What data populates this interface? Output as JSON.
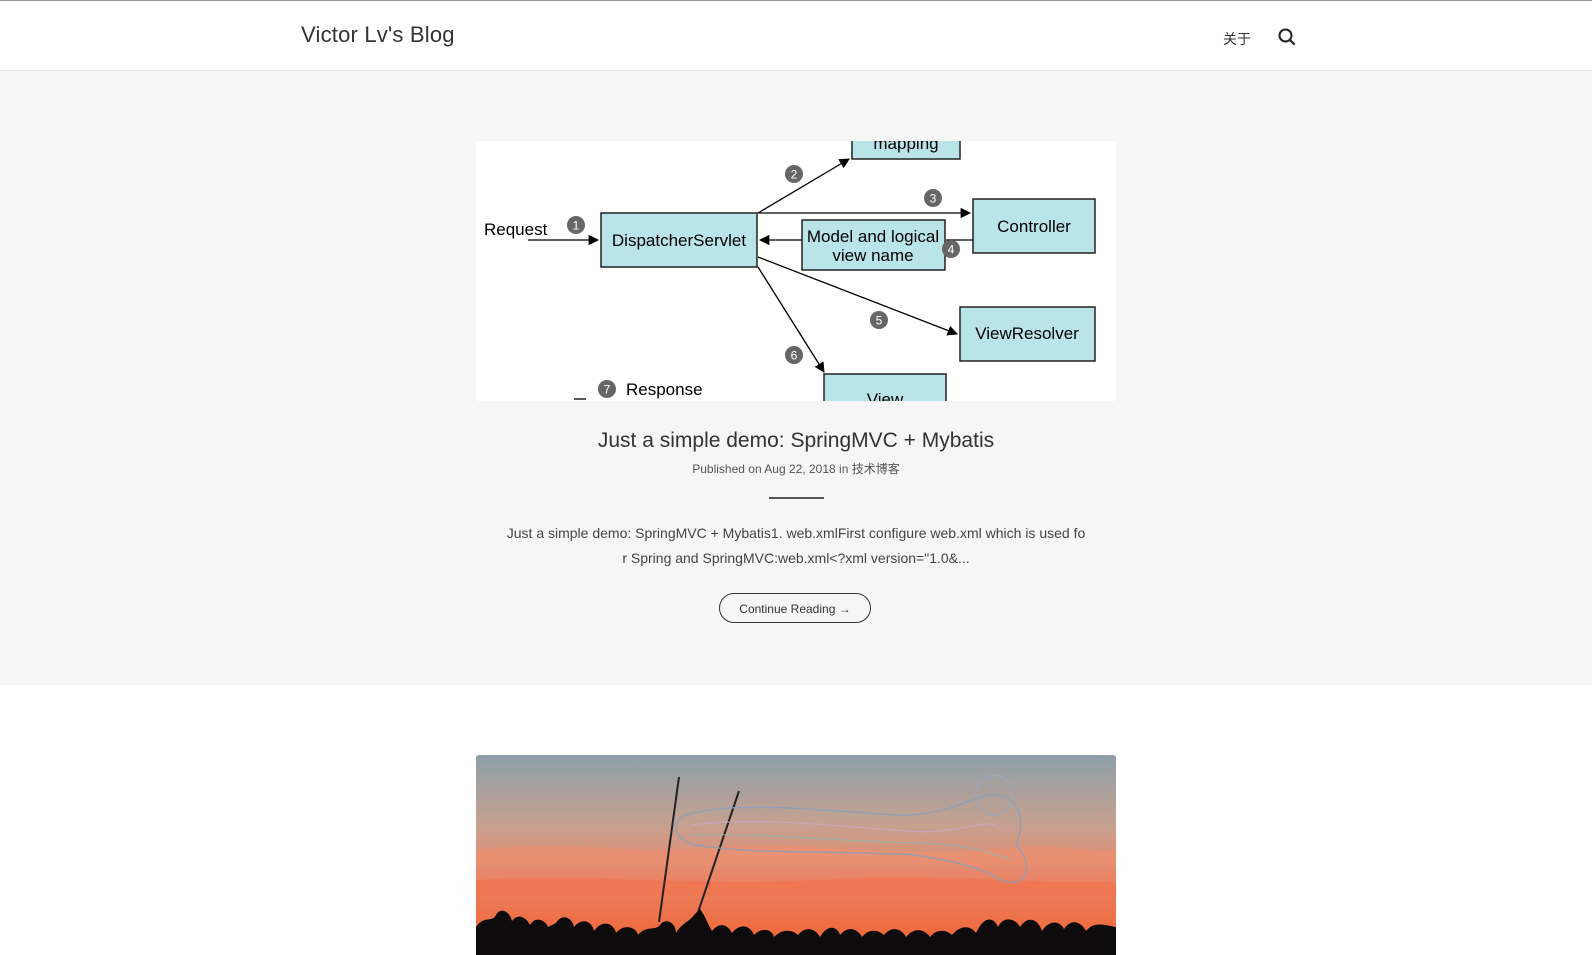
{
  "header": {
    "brand": "Victor Lv's Blog",
    "nav_about": "关于",
    "search_icon": "search-icon"
  },
  "post1": {
    "title": "Just a simple demo: SpringMVC + Mybatis",
    "meta_prefix": "Published on",
    "date": "Aug 22, 2018",
    "meta_in": "in",
    "category": "技术博客",
    "excerpt": "Just a simple demo: SpringMVC + Mybatis1. web.xmlFirst configure web.xml which is used for Spring and SpringMVC:web.xml<?xml version=\"1.0&...",
    "continue_label": "Continue Reading →",
    "diagram": {
      "request": "Request",
      "dispatcher": "DispatcherServlet",
      "mapping": "mapping",
      "controller": "Controller",
      "model_line1": "Model and logical",
      "model_line2": "view name",
      "view_resolver": "ViewResolver",
      "view": "View",
      "response": "Response",
      "steps": [
        "1",
        "2",
        "3",
        "4",
        "5",
        "6",
        "7"
      ],
      "box_color": "#b9e4e8"
    }
  },
  "post2": {
    "image": "sunset-bubbles-crowd-photo",
    "sky_colors": [
      "#8fa3ad",
      "#d98a6e",
      "#f06a3c"
    ]
  }
}
